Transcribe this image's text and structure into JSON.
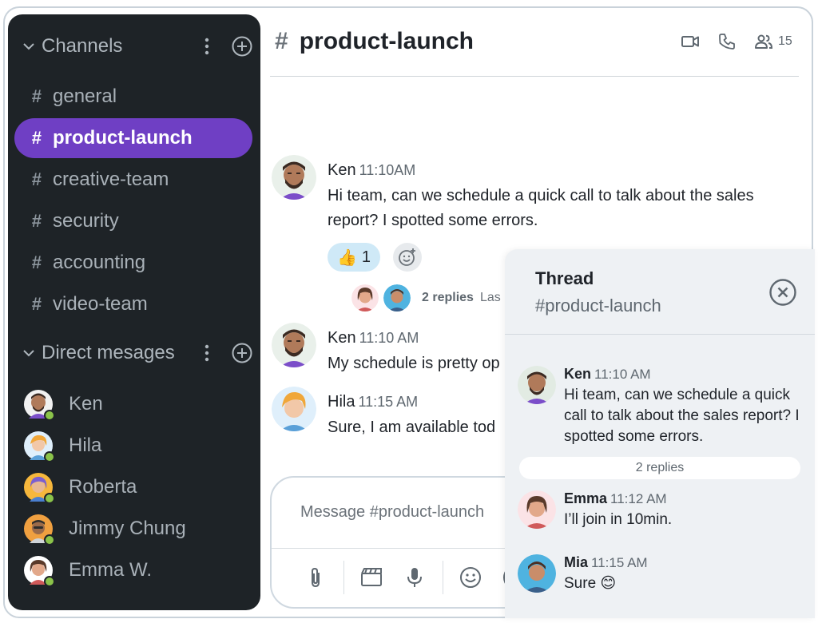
{
  "sidebar": {
    "channels_header": "Channels",
    "channels": [
      {
        "label": "general",
        "active": false
      },
      {
        "label": "product-launch",
        "active": true
      },
      {
        "label": "creative-team",
        "active": false
      },
      {
        "label": "security",
        "active": false
      },
      {
        "label": "accounting",
        "active": false
      },
      {
        "label": "video-team",
        "active": false
      }
    ],
    "dm_header": "Direct mesages",
    "dms": [
      {
        "label": "Ken",
        "status": "online"
      },
      {
        "label": "Hila",
        "status": "online"
      },
      {
        "label": "Roberta",
        "status": "online"
      },
      {
        "label": "Jimmy Chung",
        "status": "online"
      },
      {
        "label": "Emma W.",
        "status": "online"
      }
    ],
    "hash_symbol": "#"
  },
  "header": {
    "hash": "#",
    "channel_title": "product-launch",
    "member_count": "15",
    "icons": [
      "video-icon",
      "phone-icon",
      "people-icon"
    ]
  },
  "messages": [
    {
      "author": "Ken",
      "time": "11:10AM",
      "text": "Hi team, can we schedule a quick call to talk about the sales report? I spotted some errors."
    },
    {
      "author": "Ken",
      "time": "11:10 AM",
      "text": "My schedule is pretty op"
    },
    {
      "author": "Hila",
      "time": "11:15 AM",
      "text": "Sure, I am available tod"
    }
  ],
  "reaction": {
    "emoji": "👍",
    "count": "1"
  },
  "replies_summary": {
    "count_label": "2 replies",
    "last_label": "Las"
  },
  "composer": {
    "placeholder": "Message #product-launch"
  },
  "thread": {
    "title": "Thread",
    "subtitle": "#product-launch",
    "parent": {
      "author": "Ken",
      "time": "11:10 AM",
      "text": "Hi team, can we schedule a quick call to talk about the sales report? I spotted some errors."
    },
    "replies_label": "2 replies",
    "replies": [
      {
        "author": "Emma",
        "time": "11:12 AM",
        "text": "I’ll join in 10min."
      },
      {
        "author": "Mia",
        "time": "11:15 AM",
        "text": "Sure 😊"
      }
    ]
  },
  "colors": {
    "sidebar_bg": "#1e2327",
    "active_channel": "#6f3fc4",
    "online_dot": "#8bc34a",
    "reaction_bg": "#cfe9f7",
    "thread_bg": "#eef1f4"
  }
}
